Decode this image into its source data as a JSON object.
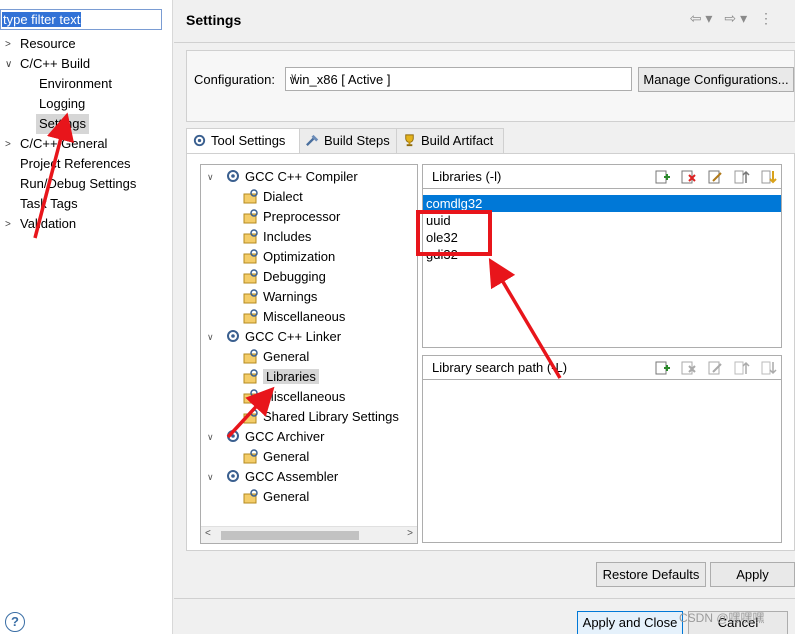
{
  "filter": {
    "value": "type filter text"
  },
  "left_tree": [
    {
      "label": "Resource",
      "expanded": false
    },
    {
      "label": "C/C++ Build",
      "expanded": true
    },
    {
      "label": "Environment"
    },
    {
      "label": "Logging"
    },
    {
      "label": "Settings",
      "selected": true
    },
    {
      "label": "C/C++ General",
      "expanded": false
    },
    {
      "label": "Project References"
    },
    {
      "label": "Run/Debug Settings"
    },
    {
      "label": "Task Tags"
    },
    {
      "label": "Validation",
      "expanded": false
    }
  ],
  "page": {
    "title": "Settings"
  },
  "config": {
    "label": "Configuration:",
    "value": "win_x86  [ Active ]",
    "manage_label": "Manage Configurations..."
  },
  "tabs": [
    {
      "label": "Tool Settings",
      "active": true
    },
    {
      "label": "Build Steps"
    },
    {
      "label": "Build Artifact"
    }
  ],
  "tool_tree": [
    {
      "label": "GCC C++ Compiler",
      "group": true
    },
    {
      "label": "Dialect"
    },
    {
      "label": "Preprocessor"
    },
    {
      "label": "Includes"
    },
    {
      "label": "Optimization"
    },
    {
      "label": "Debugging"
    },
    {
      "label": "Warnings"
    },
    {
      "label": "Miscellaneous"
    },
    {
      "label": "GCC C++ Linker",
      "group": true
    },
    {
      "label": "General"
    },
    {
      "label": "Libraries",
      "selected": true
    },
    {
      "label": "Miscellaneous"
    },
    {
      "label": "Shared Library Settings"
    },
    {
      "label": "GCC Archiver",
      "group": true
    },
    {
      "label": "General"
    },
    {
      "label": "GCC Assembler",
      "group": true
    },
    {
      "label": "General"
    }
  ],
  "libraries": {
    "header": "Libraries (-l)",
    "items": [
      "comdlg32",
      "uuid",
      "ole32",
      "gdi32"
    ]
  },
  "library_paths": {
    "header": "Library search path (-L)",
    "items": []
  },
  "buttons": {
    "restore": "Restore Defaults",
    "apply": "Apply",
    "apply_close": "Apply and Close",
    "cancel": "Cancel",
    "help": "?"
  },
  "watermark": "CSDN @嘿嘿嘿",
  "colors": {
    "annotation": "#e8151b",
    "selection": "#0078d7"
  }
}
